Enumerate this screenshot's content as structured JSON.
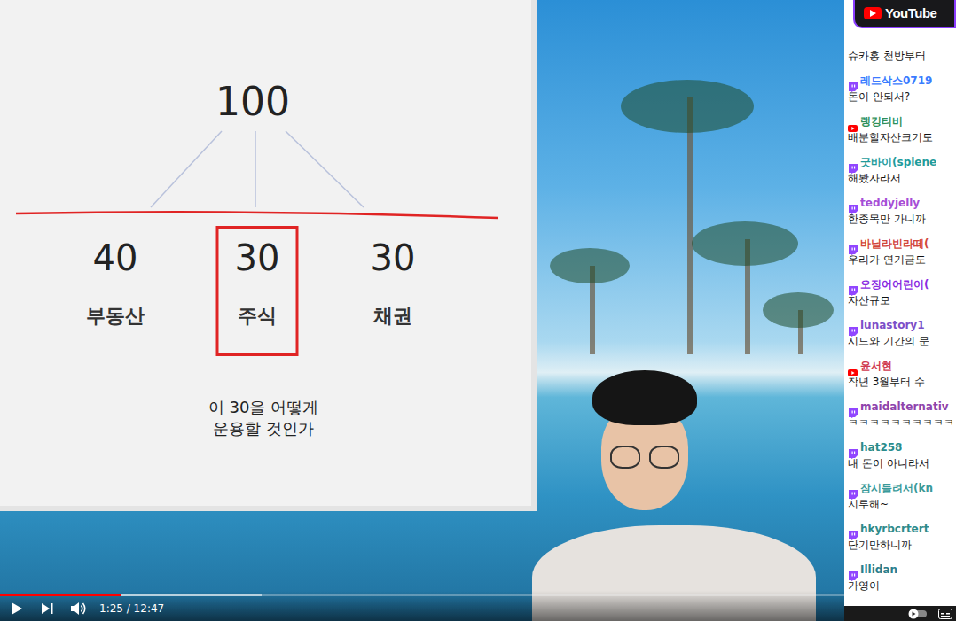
{
  "slide": {
    "root": "100",
    "branches": [
      {
        "value": "40",
        "label": "부동산",
        "selected": false
      },
      {
        "value": "30",
        "label": "주식",
        "selected": true
      },
      {
        "value": "30",
        "label": "채권",
        "selected": false
      }
    ],
    "note": "이 30을 어떻게\n운용할 것인가"
  },
  "chat": {
    "header": "YouTube",
    "messages": [
      {
        "kind": "partial",
        "text": "슈카홍 천방부터"
      },
      {
        "kind": "twitch",
        "user": "레드삭스0719",
        "text": "돈이 안되서?",
        "color": "#3a7bff"
      },
      {
        "kind": "youtube",
        "user": "랭킹티비",
        "text": "배분할자산크기도",
        "color": "#2e8f57"
      },
      {
        "kind": "twitch",
        "user": "굿바이(splene",
        "text": "해봤자라서",
        "color": "#1f9c9c"
      },
      {
        "kind": "twitch",
        "user": "teddyjelly",
        "text": "한종목만 가니까",
        "color": "#a64dd6"
      },
      {
        "kind": "twitch",
        "user": "바닐라빈라떼(",
        "text": "우리가 연기금도",
        "color": "#d2453a"
      },
      {
        "kind": "twitch",
        "user": "오징어어린이(",
        "text": "자산규모",
        "color": "#8a2be2"
      },
      {
        "kind": "twitch",
        "user": "lunastory1",
        "text": "시드와 기간의 문",
        "color": "#7b4fc9"
      },
      {
        "kind": "youtube",
        "user": "윤서현",
        "text": "작년 3월부터 수",
        "color": "#d0394f"
      },
      {
        "kind": "twitch",
        "user": "maidalternativ",
        "text": "ㅋㅋㅋㅋㅋㅋㅋㅋㅋㅋ",
        "color": "#8e44ad"
      },
      {
        "kind": "twitch",
        "user": "hat258",
        "text": "내 돈이 아니라서",
        "color": "#2a8c8c"
      },
      {
        "kind": "twitch",
        "user": "잠시들려서(kn",
        "text": "지루해~",
        "color": "#3a9a9a"
      },
      {
        "kind": "twitch",
        "user": "hkyrbcrtert",
        "text": "단기만하니까",
        "color": "#2e8b8b"
      },
      {
        "kind": "twitch",
        "user": "Illidan",
        "text": "가영이",
        "color": "#2a7f8f"
      }
    ]
  },
  "player": {
    "time": "1:25 / 12:47",
    "progress": {
      "level": 0.144,
      "buffered": 0.31
    },
    "autoplay": {
      "on": false
    }
  }
}
